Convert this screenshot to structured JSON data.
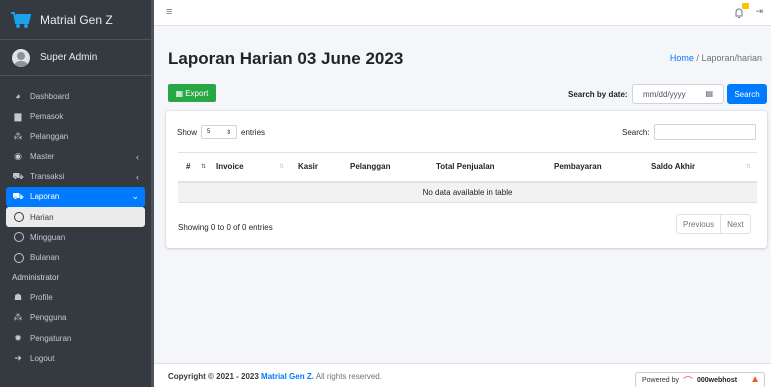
{
  "app": {
    "brand": "Matrial Gen Z",
    "user": "Super Admin"
  },
  "sidebar": {
    "items": [
      {
        "label": "Dashboard",
        "icon": "tachometer-icon"
      },
      {
        "label": "Pemasok",
        "icon": "truck-icon"
      },
      {
        "label": "Pelanggan",
        "icon": "users-icon"
      },
      {
        "label": "Master",
        "icon": "cube-icon",
        "arrow": "‹"
      },
      {
        "label": "Transaksi",
        "icon": "cart-icon",
        "arrow": "‹"
      },
      {
        "label": "Laporan",
        "icon": "cart-icon",
        "arrow": "⌄"
      }
    ],
    "sub_items": [
      {
        "label": "Harian"
      },
      {
        "label": "Mingguan"
      },
      {
        "label": "Bulanan"
      }
    ],
    "header": "Administrator",
    "admin_items": [
      {
        "label": "Profile",
        "icon": "user-icon"
      },
      {
        "label": "Pengguna",
        "icon": "users-icon"
      },
      {
        "label": "Pengaturan",
        "icon": "gear-icon"
      },
      {
        "label": "Logout",
        "icon": "logout-icon"
      }
    ]
  },
  "header": {
    "title": "Laporan Harian 03 June 2023",
    "breadcrumb_home": "Home",
    "breadcrumb_sep": "/",
    "breadcrumb_current": "Laporan/harian"
  },
  "toolbar": {
    "export_label": "Export",
    "search_by_date_label": "Search by date:",
    "date_placeholder": "mm/dd/yyyy",
    "search_button": "Search"
  },
  "table": {
    "show_label": "Show",
    "length_value": "5",
    "entries_label": "entries",
    "search_label": "Search:",
    "columns": [
      "#",
      "Invoice",
      "Kasir",
      "Pelanggan",
      "Total Penjualan",
      "Pembayaran",
      "Saldo Akhir"
    ],
    "empty_message": "No data available in table",
    "info": "Showing 0 to 0 of 0 entries",
    "prev_label": "Previous",
    "next_label": "Next"
  },
  "footer": {
    "copyright_prefix": "Copyright © 2021 - 2023 ",
    "brand": "Matrial Gen Z.",
    "suffix": " All rights reserved.",
    "powered_by": "Powered by",
    "host": "000webhost"
  },
  "colors": {
    "primary": "#007bff",
    "success": "#28a745",
    "sidebar": "#343a40",
    "warning": "#ffc107"
  }
}
